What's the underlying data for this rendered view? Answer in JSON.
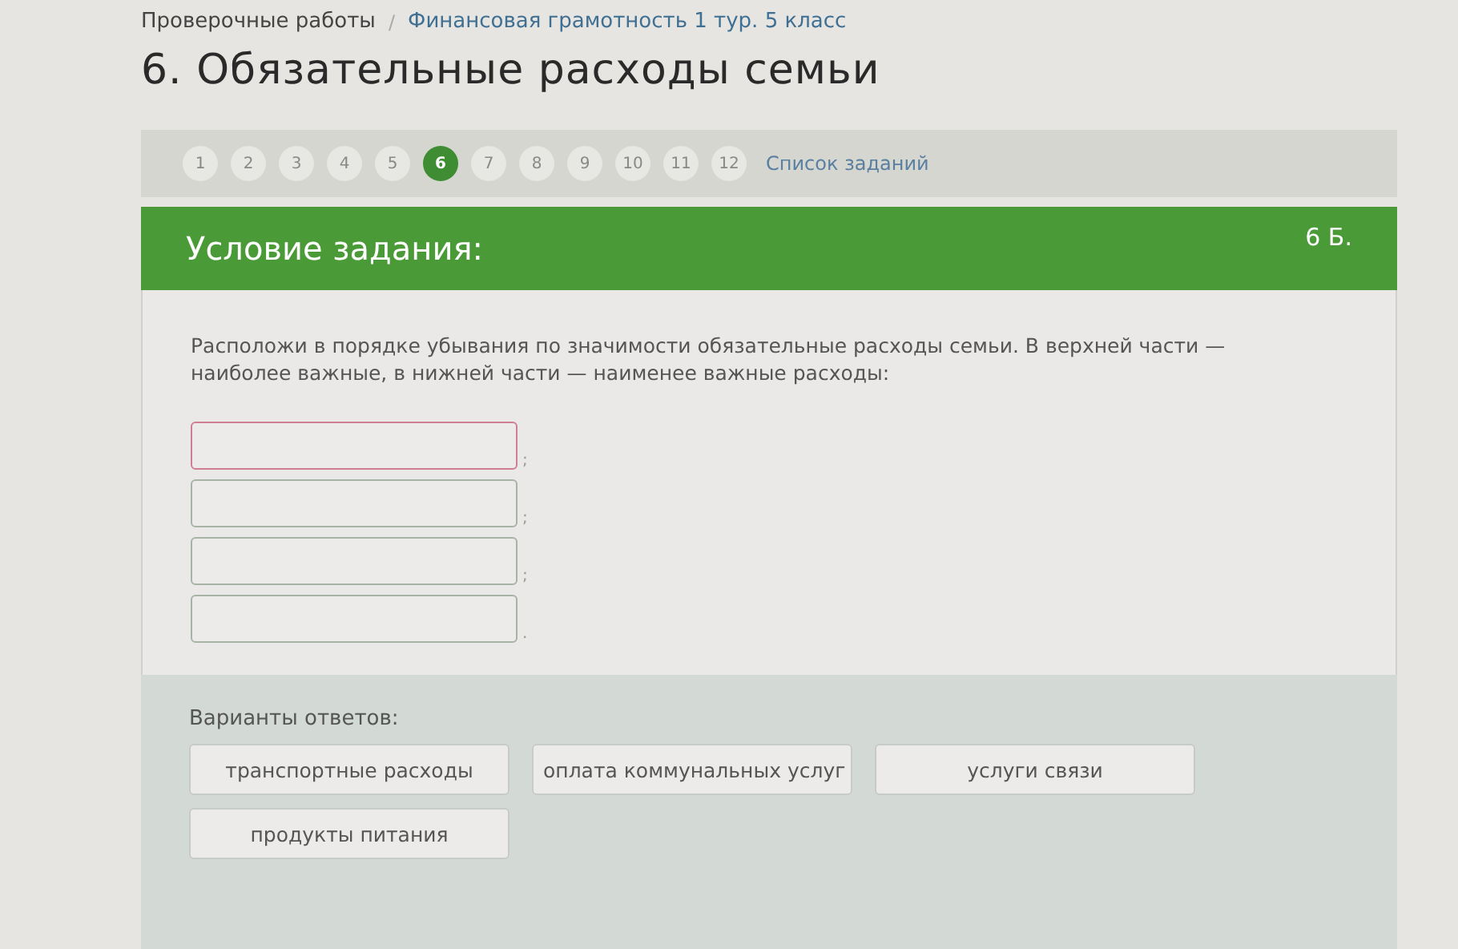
{
  "breadcrumb": [
    {
      "label": "Проверочные работы",
      "kind": "plain"
    },
    {
      "label": "Финансовая грамотность 1 тур. 5 класс",
      "kind": "link"
    }
  ],
  "breadcrumb_separator": "/",
  "title": "6. Обязательные расходы семьи",
  "task_nav": {
    "items": [
      {
        "label": "1",
        "selected": false
      },
      {
        "label": "2",
        "selected": false
      },
      {
        "label": "3",
        "selected": false
      },
      {
        "label": "4",
        "selected": false
      },
      {
        "label": "5",
        "selected": false
      },
      {
        "label": "6",
        "selected": true
      },
      {
        "label": "7",
        "selected": false
      },
      {
        "label": "8",
        "selected": false
      },
      {
        "label": "9",
        "selected": false
      },
      {
        "label": "10",
        "selected": false
      },
      {
        "label": "11",
        "selected": false
      },
      {
        "label": "12",
        "selected": false
      }
    ],
    "list_link": "Список заданий"
  },
  "task": {
    "heading": "Условие задания:",
    "points": "6 Б.",
    "text": "Расположи в порядке убывания по значимости обязательные расходы семьи. В верхней части — наиболее важные, в нижней части — наименее важные расходы:",
    "slots": [
      {
        "separator": ";",
        "highlighted": true
      },
      {
        "separator": ";",
        "highlighted": false
      },
      {
        "separator": ";",
        "highlighted": false
      },
      {
        "separator": ".",
        "highlighted": false
      }
    ]
  },
  "answers": {
    "label": "Варианты ответов:",
    "options": [
      "транспортные расходы",
      "оплата коммунальных услуг",
      "услуги связи",
      "продукты питания"
    ]
  }
}
